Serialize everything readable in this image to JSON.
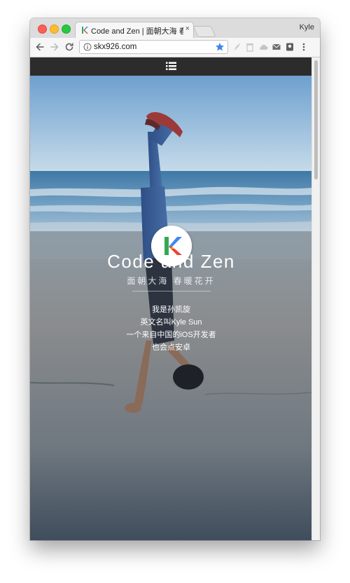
{
  "browser": {
    "tab_title": "Code and Zen | 面朝大海 春暖花开",
    "tab_close": "×",
    "profile_name": "Kyle",
    "url": "skx926.com"
  },
  "site": {
    "title": "Code and Zen",
    "subtitle": "面朝大海 春暖花开",
    "bio": [
      "我是孙凯旋",
      "英文名叫Kyle Sun",
      "一个来自中国的iOS开发者",
      "也会点安卓"
    ]
  },
  "icons": {
    "back": "back-arrow-icon",
    "forward": "forward-arrow-icon",
    "reload": "reload-icon",
    "info": "info-icon",
    "bookmark": "star-icon",
    "menu": "hamburger-menu-icon",
    "logo": "k-logo"
  },
  "colors": {
    "nav_bar": "#2c2c2c",
    "bookmark_star": "#3b86f0",
    "logo_k": [
      "#34a853",
      "#4285f4",
      "#ea4335",
      "#fbbc05"
    ]
  }
}
